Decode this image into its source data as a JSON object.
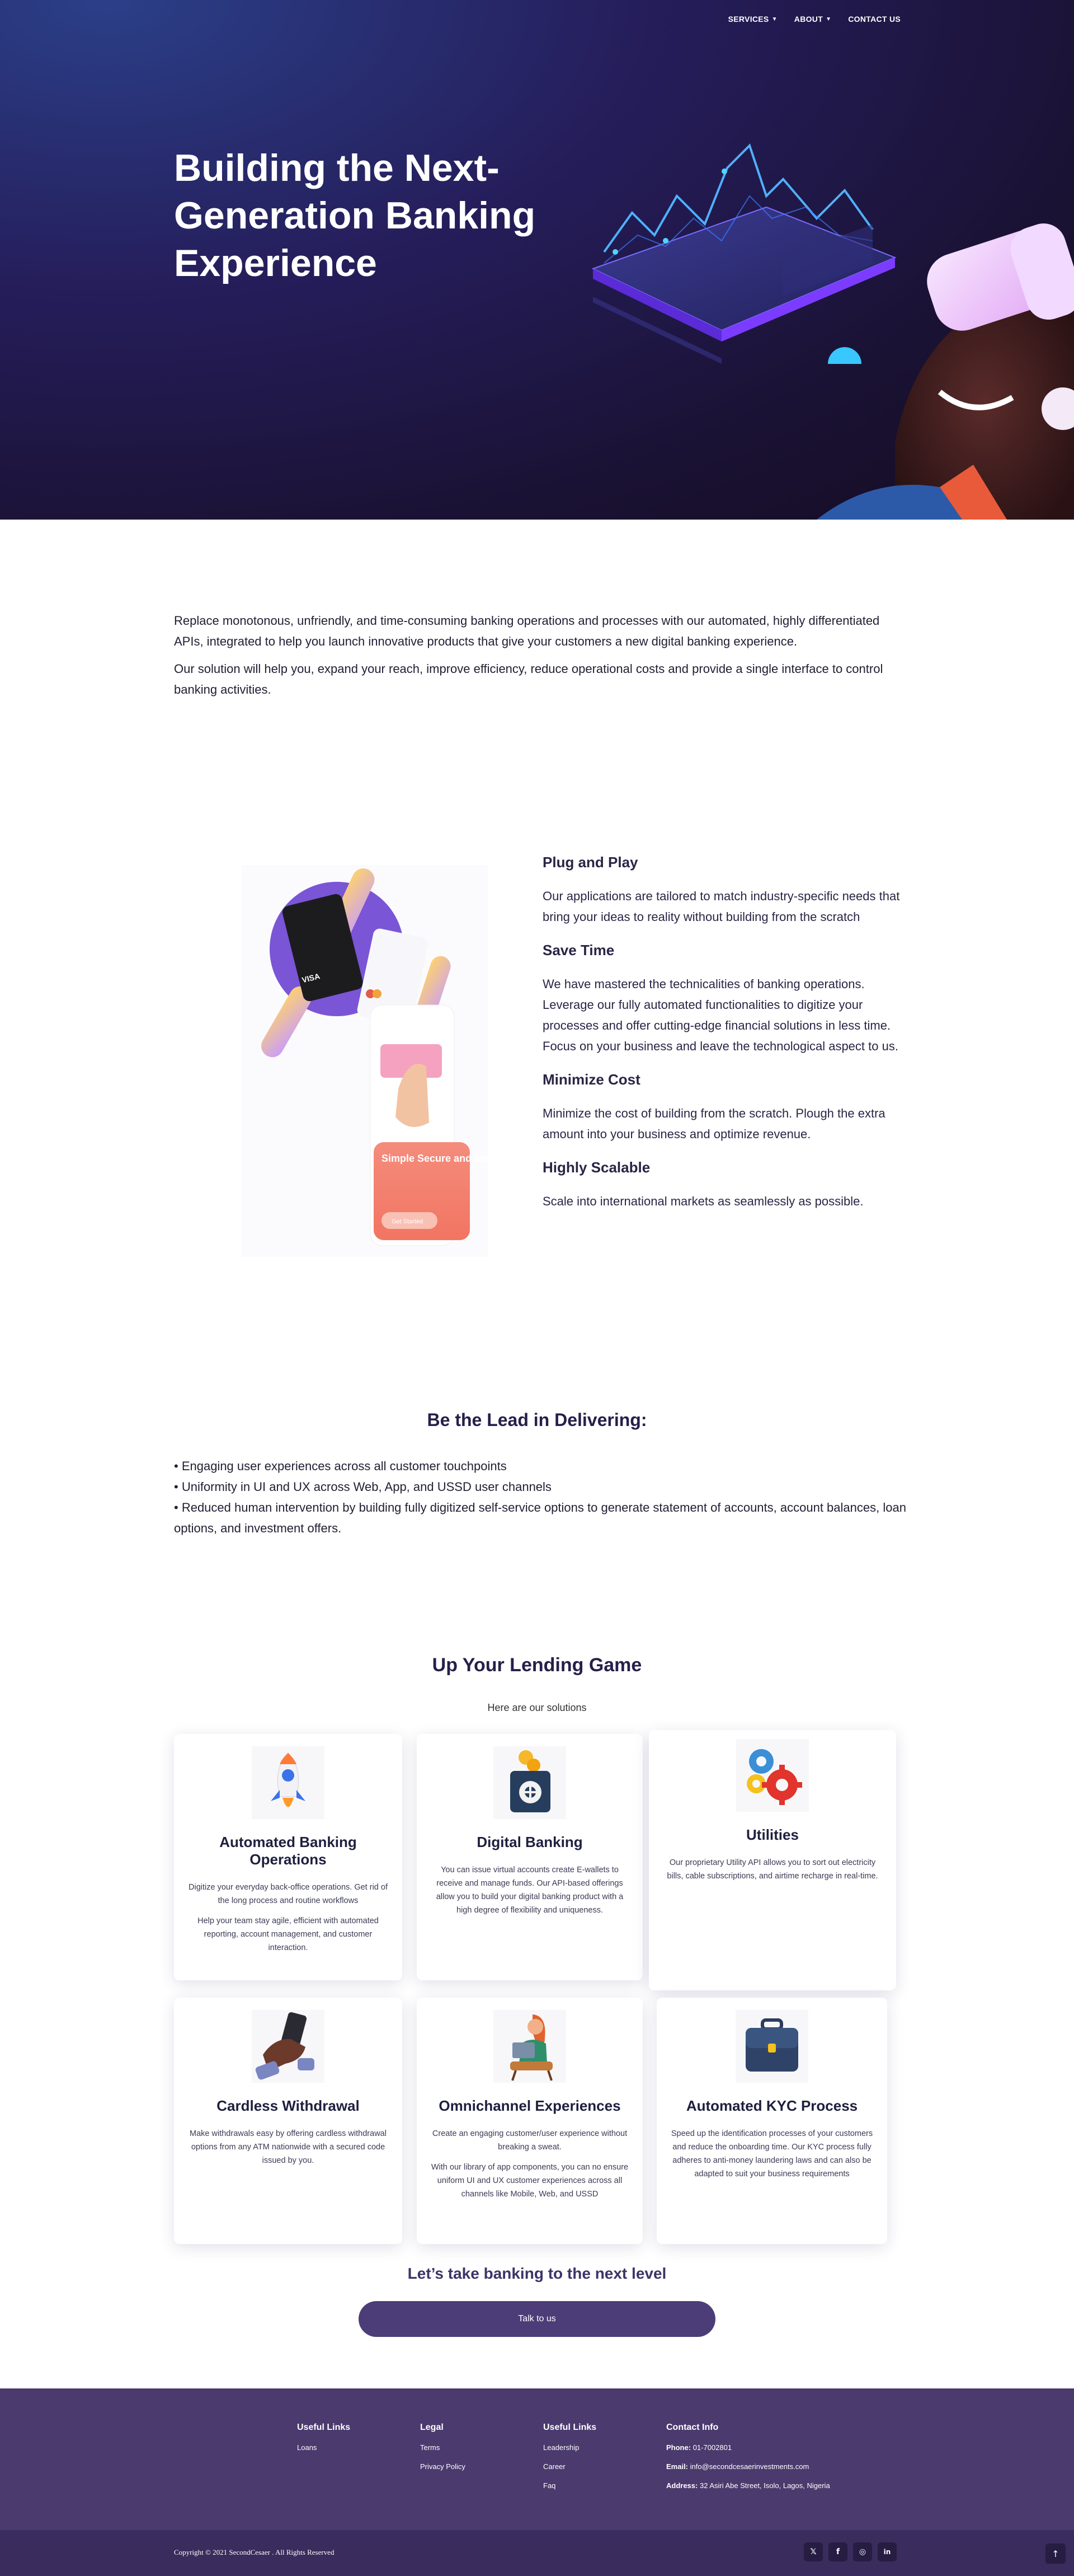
{
  "nav": {
    "items": [
      {
        "label": "SERVICES",
        "has_dropdown": true
      },
      {
        "label": "ABOUT",
        "has_dropdown": true
      },
      {
        "label": "CONTACT US",
        "has_dropdown": false
      }
    ]
  },
  "hero": {
    "title": "Building the Next-Generation Banking Experience"
  },
  "intro": {
    "p1": "Replace monotonous, unfriendly, and time-consuming banking operations and processes with our automated, highly differentiated APIs, integrated to help you launch innovative products that give your customers a new digital banking experience.",
    "p2": "Our solution will help you, expand your reach, improve efficiency, reduce operational costs and provide a single interface to control banking activities."
  },
  "features": {
    "illustration": {
      "phone_title": "Simple Secure and smart banking",
      "phone_button": "Get Started"
    },
    "items": [
      {
        "title": "Plug and Play",
        "text": "Our applications are tailored to match industry-specific needs that bring your ideas to reality without building from the scratch"
      },
      {
        "title": "Save Time",
        "text": "We have mastered the technicalities of banking operations. Leverage our fully automated functionalities to digitize your processes and offer cutting-edge financial solutions in less time. Focus on your business and leave the technological aspect to us."
      },
      {
        "title": "Minimize Cost",
        "text": "Minimize the cost of building from the scratch. Plough the extra amount into your business and optimize revenue."
      },
      {
        "title": "Highly Scalable",
        "text": "Scale into international markets as seamlessly as possible."
      }
    ]
  },
  "lead": {
    "title": "Be the Lead in Delivering:",
    "items": [
      "• Engaging user experiences across all customer touchpoints",
      "• Uniformity in UI and UX across Web, App, and USSD user channels",
      "• Reduced human intervention by building fully digitized self-service options to generate statement of accounts, account balances, loan options, and investment offers."
    ]
  },
  "lending": {
    "title": "Up Your Lending Game",
    "subtitle": "Here are our solutions",
    "cards": [
      {
        "title": "Automated Banking Operations",
        "icon": "rocket-icon",
        "texts": [
          "Digitize your everyday back-office operations. Get rid of the long process and routine workflows",
          "Help your team stay agile, efficient with automated reporting, account management, and customer interaction."
        ]
      },
      {
        "title": "Digital Banking",
        "icon": "safe-coins-icon",
        "texts": [
          "You can issue virtual accounts create E-wallets to receive and manage funds. Our API-based offerings allow you to build your digital banking product with a high degree of flexibility and uniqueness."
        ]
      },
      {
        "title": "Utilities",
        "icon": "gears-icon",
        "texts": [
          "Our proprietary Utility API allows you to sort out electricity bills, cable subscriptions, and airtime recharge in real-time."
        ]
      },
      {
        "title": "Cardless Withdrawal",
        "icon": "hand-phone-icon",
        "texts": [
          "Make withdrawals easy by offering cardless withdrawal options from any ATM nationwide with a secured code issued by you."
        ]
      },
      {
        "title": "Omnichannel Experiences",
        "icon": "woman-laptop-icon",
        "texts": [
          "Create an engaging customer/user experience without breaking a sweat.",
          "With our library of app components, you can no ensure uniform UI and UX customer experiences across all channels like Mobile, Web, and USSD"
        ]
      },
      {
        "title": "Automated KYC Process",
        "icon": "briefcase-icon",
        "texts": [
          "Speed up the identification processes of your customers and reduce the onboarding time. Our KYC process fully adheres to anti-money laundering laws and can also be adapted to suit your business requirements"
        ]
      }
    ],
    "next_title": "Let’s take banking to the next level",
    "cta_label": "Talk to us"
  },
  "footer": {
    "col1": {
      "head": "Useful Links",
      "links": [
        "Loans"
      ]
    },
    "col2": {
      "head": "Legal",
      "links": [
        "Terms",
        "Privacy Policy"
      ]
    },
    "col3": {
      "head": "Useful Links",
      "links": [
        "Leadership",
        "Career",
        "Faq"
      ]
    },
    "contact": {
      "head": "Contact Info",
      "phone_label": "Phone:",
      "phone": "01-7002801",
      "email_label": "Email:",
      "email": "info@secondcesaerinvestments.com",
      "address_label": "Address:",
      "address": "32 Asiri Abe Street, Isolo, Lagos, Nigeria"
    },
    "copyright": "Copyright © 2021 SecondCesaer . All Rights Reserved",
    "socials": [
      {
        "glyph": "𝕏",
        "icon": "twitter-icon"
      },
      {
        "glyph": "f",
        "icon": "facebook-icon"
      },
      {
        "glyph": "◎",
        "icon": "instagram-icon"
      },
      {
        "glyph": "in",
        "icon": "linkedin-icon"
      }
    ],
    "to_top": "↑"
  }
}
